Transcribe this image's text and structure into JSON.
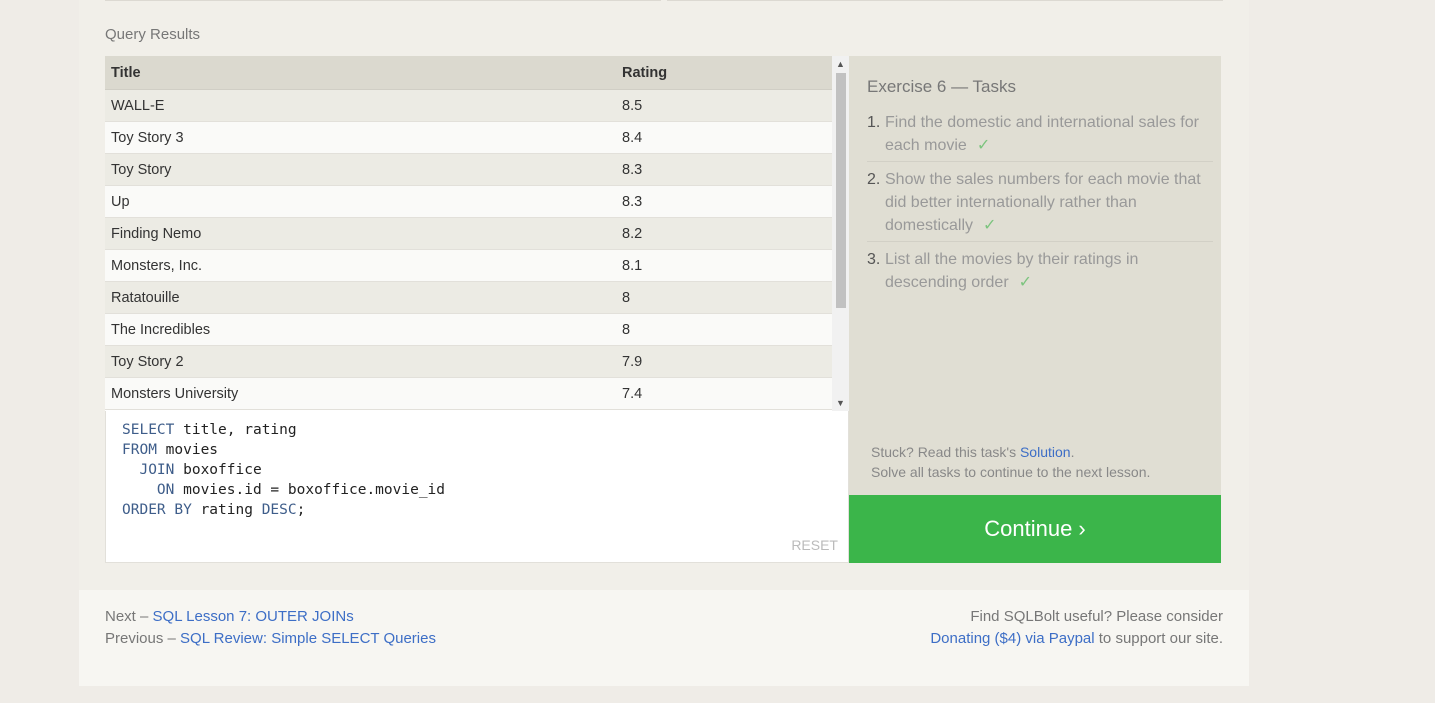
{
  "query_results_heading": "Query Results",
  "table": {
    "columns": [
      "Title",
      "Rating"
    ],
    "rows": [
      [
        "WALL-E",
        "8.5"
      ],
      [
        "Toy Story 3",
        "8.4"
      ],
      [
        "Toy Story",
        "8.3"
      ],
      [
        "Up",
        "8.3"
      ],
      [
        "Finding Nemo",
        "8.2"
      ],
      [
        "Monsters, Inc.",
        "8.1"
      ],
      [
        "Ratatouille",
        "8"
      ],
      [
        "The Incredibles",
        "8"
      ],
      [
        "Toy Story 2",
        "7.9"
      ],
      [
        "Monsters University",
        "7.4"
      ]
    ]
  },
  "editor": {
    "lines": [
      {
        "indent": "",
        "kw": "SELECT",
        "rest": " title, rating"
      },
      {
        "indent": "",
        "kw": "FROM",
        "rest": " movies"
      },
      {
        "indent": "  ",
        "kw": "JOIN",
        "rest": " boxoffice"
      },
      {
        "indent": "    ",
        "kw": "ON",
        "rest": " movies.id = boxoffice.movie_id"
      },
      {
        "indent": "",
        "kw": "ORDER BY",
        "rest": " rating ",
        "kw2": "DESC",
        "tail": ";"
      }
    ],
    "reset_label": "RESET"
  },
  "tasks": {
    "title": "Exercise 6 — Tasks",
    "items": [
      {
        "num": "1.",
        "text": "Find the domestic and international sales for each movie",
        "check": "✓"
      },
      {
        "num": "2.",
        "text": "Show the sales numbers for each movie that did better internationally rather than domestically",
        "check": "✓"
      },
      {
        "num": "3.",
        "text": "List all the movies by their ratings in descending order",
        "check": "✓"
      }
    ],
    "stuck_prefix": "Stuck? Read this task's ",
    "solution_link": "Solution",
    "stuck_suffix": ".",
    "solve_all": "Solve all tasks to continue to the next lesson."
  },
  "continue_label": "Continue ›",
  "footer": {
    "next_prefix": "Next – ",
    "next_link": "SQL Lesson 7: OUTER JOINs",
    "prev_prefix": "Previous – ",
    "prev_link": "SQL Review: Simple SELECT Queries",
    "right_line1": "Find SQLBolt useful? Please consider",
    "donate_link": "Donating ($4) via Paypal",
    "right_suffix": " to support our site."
  },
  "colors": {
    "accent_green": "#3bb54a",
    "link_blue": "#3d6ec6",
    "check_green": "#7cc47e"
  }
}
